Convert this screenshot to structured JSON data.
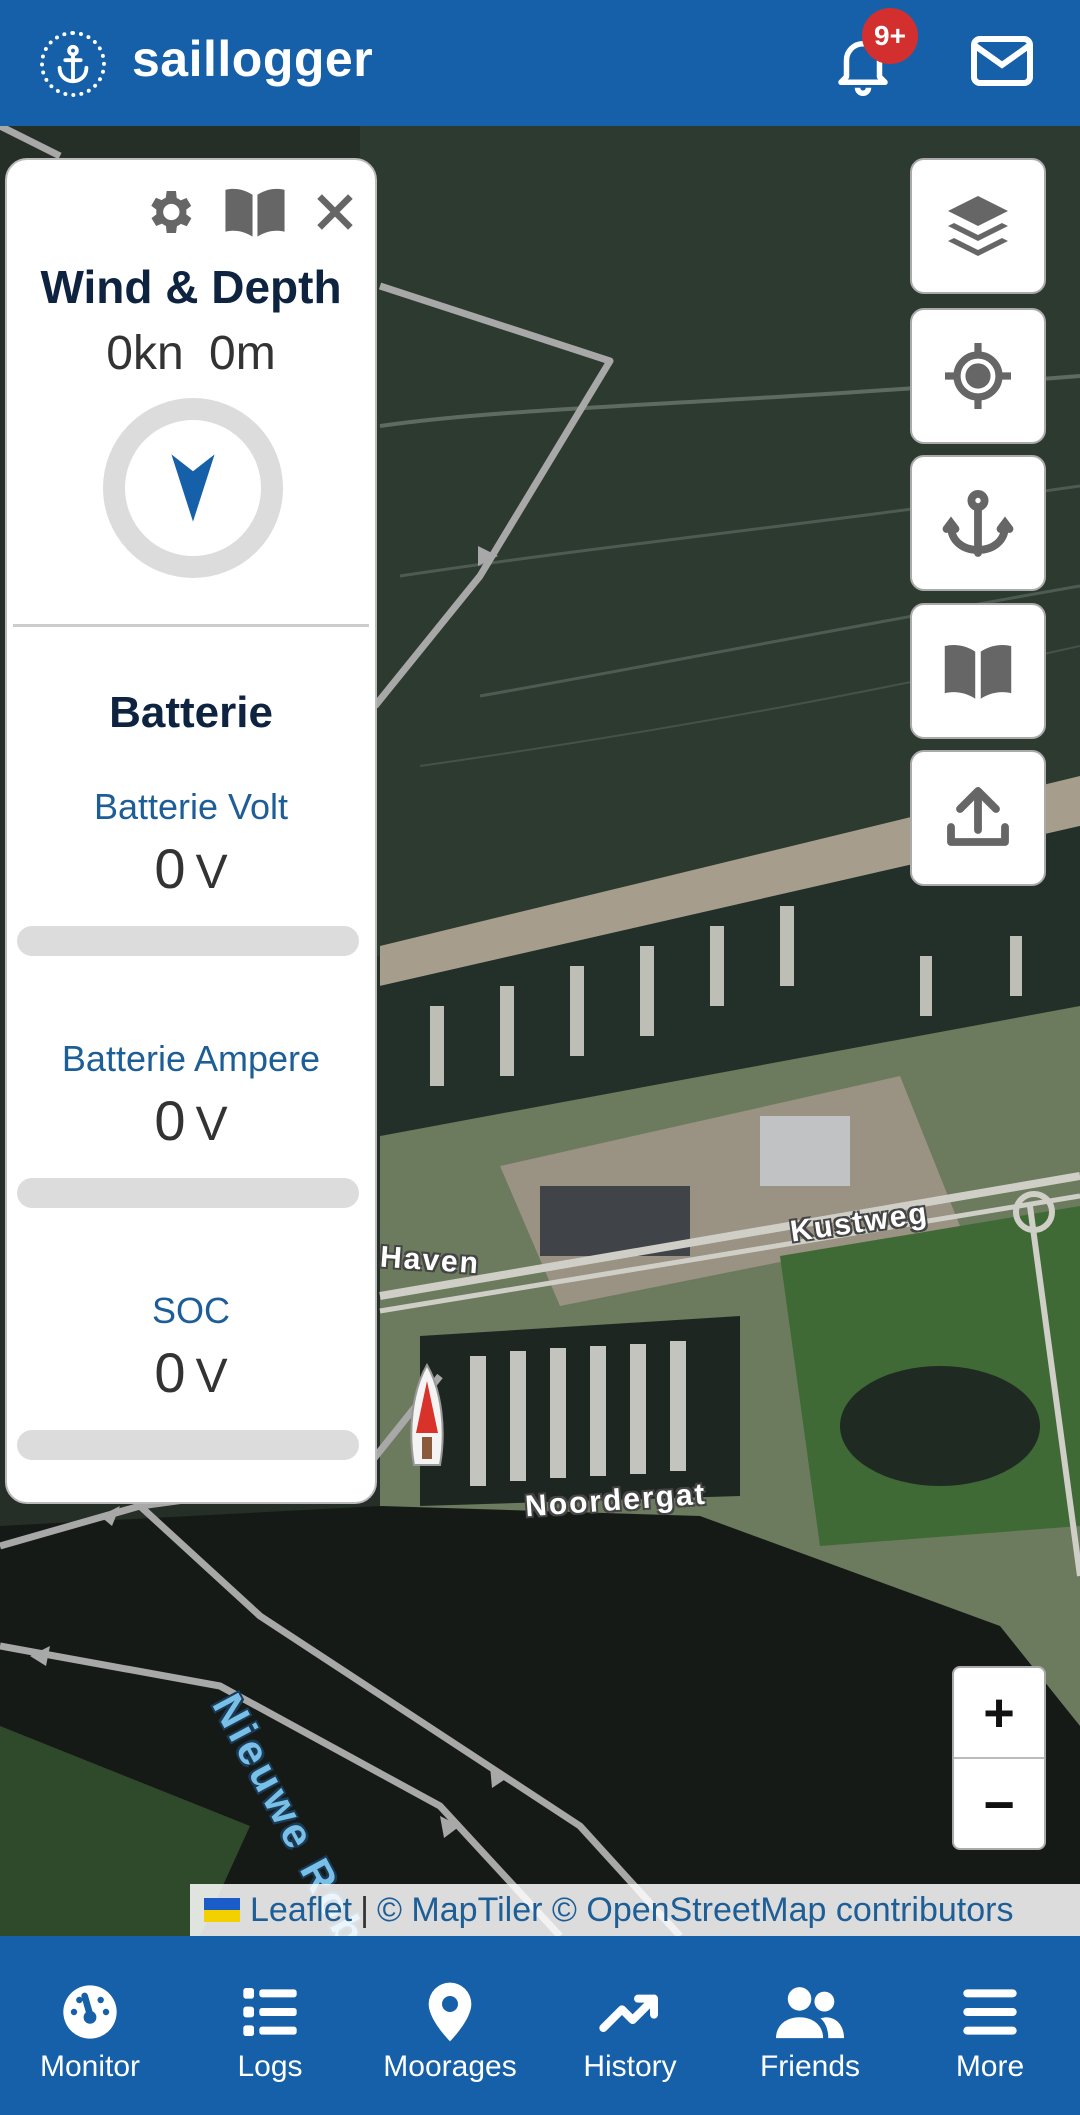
{
  "header": {
    "app_name": "saillogger",
    "notification_badge": "9+"
  },
  "wind_panel": {
    "title": "Wind & Depth",
    "wind_speed": "0kn",
    "depth": "0m"
  },
  "battery_panel": {
    "title": "Batterie",
    "metrics": [
      {
        "label": "Batterie Volt",
        "value": "0",
        "unit": "V",
        "level": 0
      },
      {
        "label": "Batterie Ampere",
        "value": "0",
        "unit": "V",
        "level": 0
      },
      {
        "label": "SOC",
        "value": "0",
        "unit": "V",
        "level": 0
      }
    ]
  },
  "map": {
    "labels": {
      "kustweg": "Kustweg",
      "haven": "Haven",
      "noordergat": "Noordergat",
      "nieuwe_robbengat": "Nieuwe Robbeng"
    },
    "zoom_in": "+",
    "zoom_out": "−"
  },
  "attribution": {
    "leaflet": "Leaflet",
    "separator": "|",
    "credits": "© MapTiler © OpenStreetMap contributors"
  },
  "bottom_nav": [
    {
      "label": "Monitor",
      "icon": "gauge-icon"
    },
    {
      "label": "Logs",
      "icon": "list-icon"
    },
    {
      "label": "Moorages",
      "icon": "map-pin-icon"
    },
    {
      "label": "History",
      "icon": "trend-icon"
    },
    {
      "label": "Friends",
      "icon": "users-icon"
    },
    {
      "label": "More",
      "icon": "menu-icon"
    }
  ],
  "colors": {
    "primary": "#1560a8",
    "badge": "#d32f2f",
    "text_dark": "#0d2340",
    "metric_label": "#1e5e96"
  }
}
